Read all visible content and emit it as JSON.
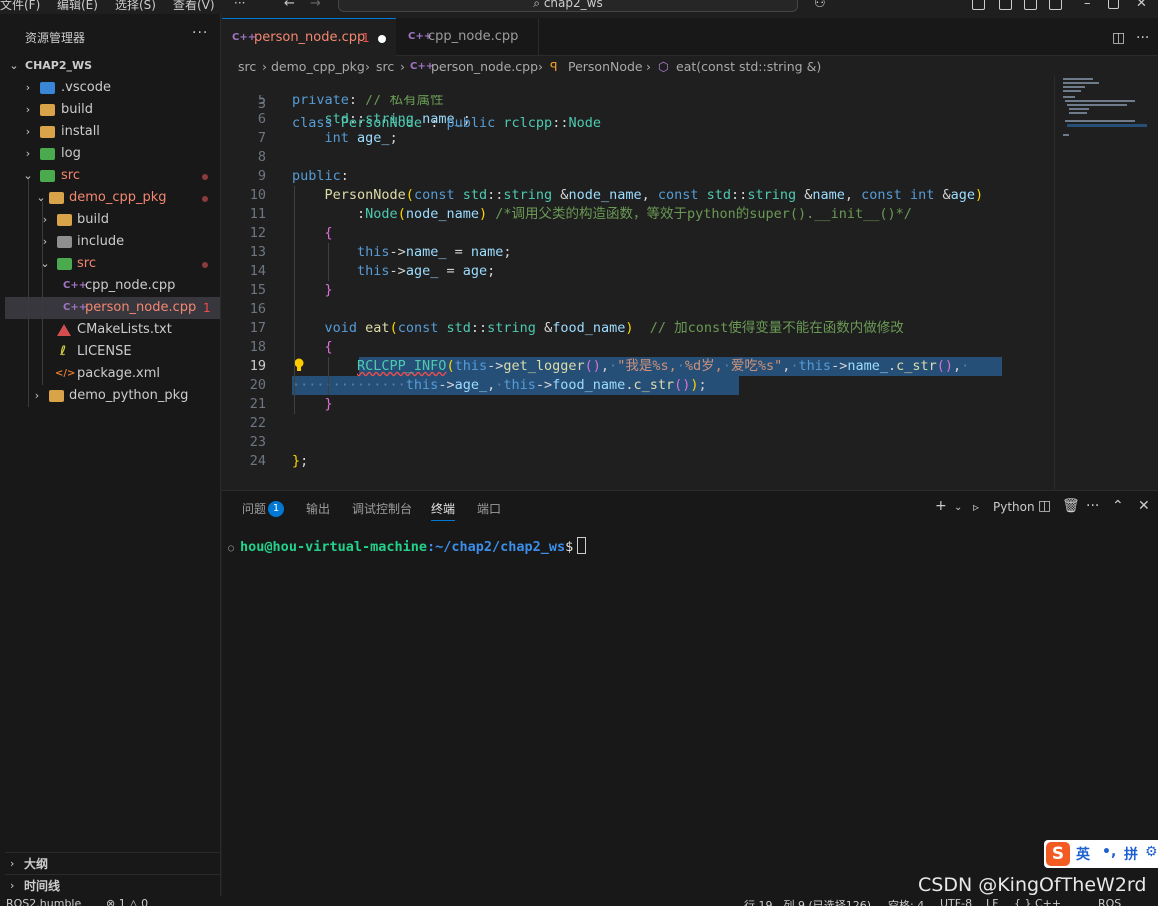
{
  "titlebar": {
    "menus": [
      "文件(F)",
      "编辑(E)",
      "选择(S)",
      "查看(V)",
      "···"
    ],
    "search": "chap2_ws"
  },
  "sidebar": {
    "title": "资源管理器",
    "more": "···",
    "workspace": "CHAP2_WS",
    "items": [
      {
        "label": ".vscode"
      },
      {
        "label": "build"
      },
      {
        "label": "install"
      },
      {
        "label": "log"
      },
      {
        "label": "src"
      },
      {
        "label": "demo_cpp_pkg"
      },
      {
        "label": "build"
      },
      {
        "label": "include"
      },
      {
        "label": "src"
      },
      {
        "label": "cpp_node.cpp"
      },
      {
        "label": "person_node.cpp",
        "problems": "1"
      },
      {
        "label": "CMakeLists.txt"
      },
      {
        "label": "LICENSE"
      },
      {
        "label": "package.xml"
      },
      {
        "label": "demo_python_pkg"
      }
    ],
    "outline": "大纲",
    "timeline": "时间线"
  },
  "tabs": [
    {
      "label": "person_node.cpp",
      "problems": "1"
    },
    {
      "label": "cpp_node.cpp"
    }
  ],
  "breadcrumb": [
    "src",
    "demo_cpp_pkg",
    "src",
    "person_node.cpp",
    "PersonNode",
    "eat(const std::string &)"
  ],
  "editor": {
    "sticky": {
      "num": "3",
      "text": "class PersonNode : public rclcpp::Node"
    },
    "line_numbers": [
      "5",
      "6",
      "7",
      "8",
      "9",
      "10",
      "11",
      "12",
      "13",
      "14",
      "15",
      "16",
      "17",
      "18",
      "19",
      "20",
      "21",
      "22",
      "23",
      "24"
    ],
    "current_line": "19"
  },
  "panel": {
    "tabs": [
      "问题",
      "输出",
      "调试控制台",
      "终端",
      "端口"
    ],
    "problems_count": "1",
    "shell": "Python",
    "prompt_user": "hou@hou-virtual-machine",
    "prompt_path": ":~/chap2/chap2_ws",
    "prompt_symbol": "$"
  },
  "statusbar": {
    "left": "ROS2.humble",
    "errors": "⊗ 1 △ 0",
    "cursor": "行 19，列 9 (已选择126)",
    "spaces": "空格: 4",
    "encoding": "UTF-8",
    "eol": "LF",
    "lang": "{ } C++",
    "ros": "ROS"
  },
  "watermark": "CSDN @KingOfTheW2rd",
  "ime": {
    "logo": "S",
    "lang": "英",
    "punct": "•,",
    "mode": "拼"
  },
  "colors": {
    "accent": "#0078d4",
    "selection": "#264f78",
    "error": "#f14c4c"
  }
}
